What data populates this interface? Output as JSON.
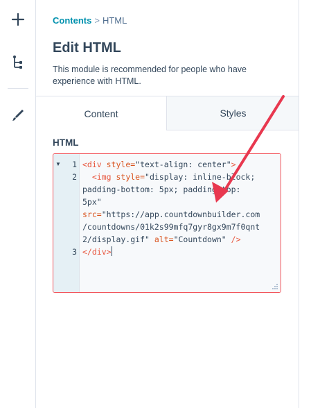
{
  "rail": {
    "add_label": "+"
  },
  "breadcrumb": {
    "parent": "Contents",
    "separator": ">",
    "current": "HTML"
  },
  "header": {
    "title": "Edit HTML",
    "description": "This module is recommended for people who have experience with HTML."
  },
  "tabs": [
    {
      "label": "Content"
    },
    {
      "label": "Styles"
    }
  ],
  "editor": {
    "label": "HTML",
    "line_numbers": [
      "1",
      "2",
      "3"
    ],
    "lines": {
      "l1_open": "<div",
      "l1_attr": " style=",
      "l1_val": "\"text-align: center\"",
      "l1_close": ">",
      "l2_open": "  <img",
      "l2_attr": " style=",
      "l2_val_a": "\"display: inline-block;",
      "l2_val_b": "padding-bottom: 5px; padding-top:",
      "l2_val_c": "5px\"",
      "l2_src_attr": "src=",
      "l2_src_a": "\"https://app.countdownbuilder.com",
      "l2_src_b": "/countdowns/01k2s99mfq7gyr8gx9m7f0qnt",
      "l2_src_c": "2/display.gif\"",
      "l2_alt_attr": " alt=",
      "l2_alt_val": "\"Countdown\"",
      "l2_end": " />",
      "l3": "</div>"
    }
  },
  "colors": {
    "accent": "#0091ae",
    "error_border": "#f2545b",
    "arrow": "#e8384f"
  }
}
